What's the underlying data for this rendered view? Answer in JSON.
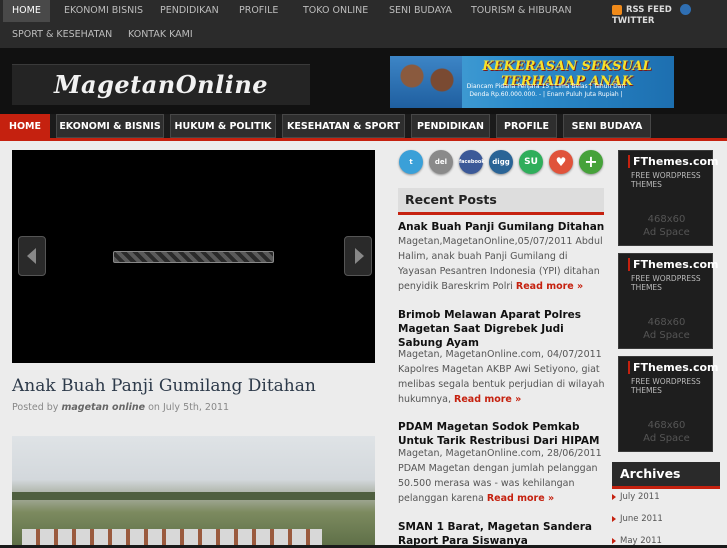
{
  "topnav": {
    "items": [
      "HOME",
      "EKONOMI BISNIS",
      "PENDIDIKAN",
      "PROFILE",
      "TOKO ONLINE",
      "SENI BUDAYA",
      "TOURISM & HIBURAN",
      "SPORT & KESEHATAN",
      "KONTAK KAMI"
    ],
    "rss": "RSS FEED",
    "twitter": "TWITTER"
  },
  "header": {
    "logo": "MagetanOnline",
    "banner_title": "KEKERASAN SEKSUAL TERHADAP ANAK",
    "banner_sub": "Diancam Pidana Penjara 15 | Lima Belas | Tahun Dan Denda Rp.60.000.000. - | Enam Puluh Juta Rupiah |"
  },
  "mainnav": [
    "HOME",
    "EKONOMI & BISNIS",
    "HUKUM & POLITIK",
    "KESEHATAN & SPORT",
    "PENDIDIKAN",
    "PROFILE",
    "SENI BUDAYA"
  ],
  "post": {
    "title": "Anak Buah Panji Gumilang Ditahan",
    "meta_prefix": "Posted by",
    "author": "magetan online",
    "meta_on": "on",
    "date": "July 5th, 2011"
  },
  "social": [
    {
      "name": "twitter",
      "label": "t",
      "color": "#3aa0d8"
    },
    {
      "name": "delicious",
      "label": "del",
      "color": "#8a8a8a"
    },
    {
      "name": "facebook",
      "label": "facebook",
      "color": "#3b5998"
    },
    {
      "name": "digg",
      "label": "digg",
      "color": "#2a6496"
    },
    {
      "name": "stumbleupon",
      "label": "SU",
      "color": "#2fae5b"
    },
    {
      "name": "favorite",
      "label": "♥",
      "color": "#e0533b"
    },
    {
      "name": "add",
      "label": "+",
      "color": "#46a23a"
    }
  ],
  "recent": {
    "heading": "Recent Posts",
    "read_more": "Read more »",
    "posts": [
      {
        "title": "Anak Buah Panji Gumilang Ditahan",
        "excerpt": "Magetan,MagetanOnline,05/07/2011 Abdul Halim, anak buah Panji Gumilang di Yayasan Pesantren Indonesia (YPI) ditahan penyidik Bareskrim Polri"
      },
      {
        "title": "Brimob Melawan Aparat Polres Magetan Saat Digrebek Judi Sabung Ayam",
        "excerpt": "Magetan, MagetanOnline.com, 04/07/2011 Kapolres Magetan AKBP Awi Setiyono, giat melibas segala bentuk perjudian di wilayah hukumnya,"
      },
      {
        "title": "PDAM Magetan Sodok Pemkab Untuk Tarik Restribusi Dari HIPAM",
        "excerpt": "Magetan, MagetanOnline.com, 28/06/2011 PDAM Magetan dengan jumlah pelanggan 50.500 merasa was - was kehilangan pelanggan karena"
      },
      {
        "title": "SMAN 1 Barat, Magetan Sandera Raport Para Siswanya",
        "excerpt": ""
      }
    ]
  },
  "ads": [
    {
      "title": "FThemes.com",
      "sub": "FREE WORDPRESS THEMES",
      "size": "468x60",
      "label": "Ad Space"
    },
    {
      "title": "FThemes.com",
      "sub": "FREE WORDPRESS THEMES",
      "size": "468x60",
      "label": "Ad Space"
    },
    {
      "title": "FThemes.com",
      "sub": "FREE WORDPRESS THEMES",
      "size": "468x60",
      "label": "Ad Space"
    }
  ],
  "archives": {
    "heading": "Archives",
    "items": [
      "July 2011",
      "June 2011",
      "May 2011"
    ]
  },
  "colors": {
    "accent": "#c5210f",
    "nav_bg": "#2b2b2b",
    "content_bg": "#ececec"
  }
}
